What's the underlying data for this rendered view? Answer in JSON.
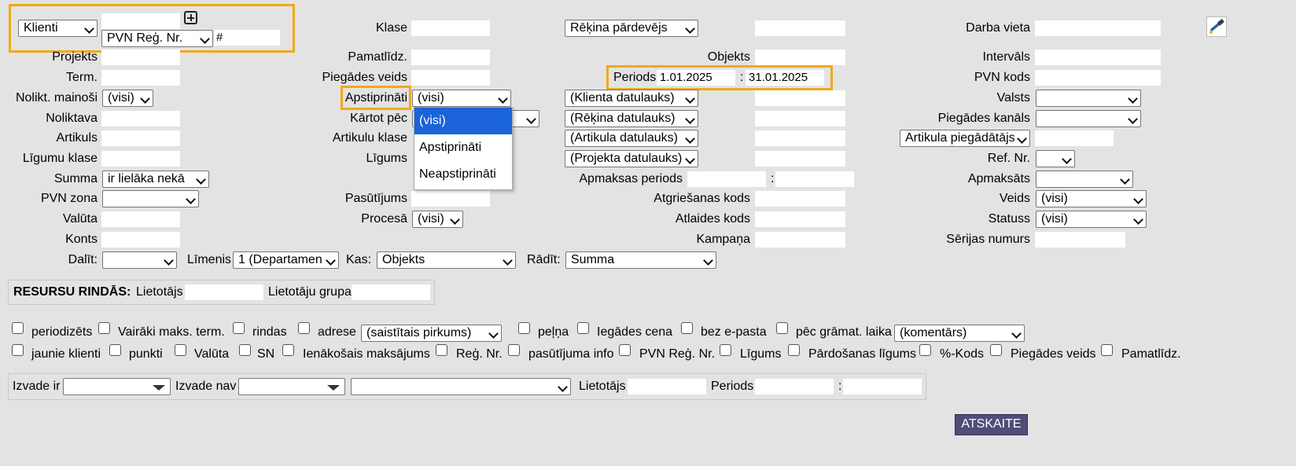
{
  "top": {
    "type_select": "Klienti",
    "vat_select": "PVN Reģ. Nr.",
    "hash": "#"
  },
  "col2": {
    "klase": "Klase",
    "pamatlidz": "Pamatlīdz.",
    "piegades_veids": "Piegādes veids",
    "apstiprinati": "Apstiprināti",
    "apstiprinati_value": "(visi)",
    "kartot_pec": "Kārtot pēc",
    "artikulu_klase": "Artikulu klase",
    "ligums": "Līgums",
    "pasutijums": "Pasūtījums",
    "procesa": "Procesā",
    "procesa_value": "(visi)"
  },
  "dropdown": {
    "options": [
      "(visi)",
      "Apstiprināti",
      "Neapstiprināti"
    ]
  },
  "col1": {
    "projekts": "Projekts",
    "term": "Term.",
    "nolikt_mainosi": "Nolikt. mainoši",
    "nolikt_mainosi_value": "(visi)",
    "noliktava": "Noliktava",
    "artikuls": "Artikuls",
    "ligumu_klase": "Līgumu klase",
    "summa": "Summa",
    "summa_value": "ir lielāka nekā",
    "pvn_zona": "PVN zona",
    "valuta": "Valūta",
    "konts": "Konts"
  },
  "col3": {
    "rekina_pardevejs": "Rēķina pārdevējs",
    "objekts": "Objekts",
    "periods": "Periods",
    "period_from": "1.01.2025",
    "period_to": "31.01.2025",
    "period_sep": ":",
    "klienta_datulauks": "(Klienta datulauks)",
    "rekina_datulauks": "(Rēķina datulauks)",
    "artikula_datulauks": "(Artikula datulauks)",
    "projekta_datulauks": "(Projekta datulauks)",
    "apmaksas_periods": "Apmaksas periods",
    "apmaksas_sep": ":",
    "atgriesanas_kods": "Atgriešanas kods",
    "atlaides_kods": "Atlaides kods",
    "kampana": "Kampaņa"
  },
  "col4": {
    "darba_vieta": "Darba vieta",
    "intervals": "Intervāls",
    "pvn_kods": "PVN kods",
    "valsts": "Valsts",
    "piegades_kanals": "Piegādes kanāls",
    "artikula_piegadatajs": "Artikula piegādātājs",
    "ref_nr": "Ref. Nr.",
    "apmaksats": "Apmaksāts",
    "veids": "Veids",
    "veids_value": "(visi)",
    "statuss": "Statuss",
    "statuss_value": "(visi)",
    "serijas_numurs": "Sērijas numurs"
  },
  "grouping": {
    "dalit": "Dalīt:",
    "limenis": "Līmenis",
    "limenis_value": "1 (Departamen",
    "kas": "Kas:",
    "kas_value": "Objekts",
    "radit": "Rādīt:",
    "radit_value": "Summa"
  },
  "resources": {
    "title": "RESURSU RINDĀS:",
    "lietotajs": "Lietotājs",
    "lietotaju_grupa": "Lietotāju grupa"
  },
  "checkboxes_row1": {
    "periodizets": "periodizēts",
    "vairaki": "Vairāki maks. term.",
    "rindas": "rindas",
    "adrese": "adrese",
    "adrese_select": "(saistītais pirkums)",
    "pelna": "peļņa",
    "iegades_cena": "Iegādes cena",
    "bez_epasta": "bez e-pasta",
    "pec_gramat": "pēc grāmat. laika",
    "komentars_select": "(komentārs)"
  },
  "checkboxes_row2": {
    "jaunie_klienti": "jaunie klienti",
    "punkti": "punkti",
    "valuta": "Valūta",
    "sn": "SN",
    "ienakosais": "Ienākošais maksājums",
    "reg_nr": "Reģ. Nr.",
    "pasutijuma_info": "pasūtījuma info",
    "pvn_reg_nr": "PVN Reģ. Nr.",
    "ligums": "Līgums",
    "pardosanas_ligums": "Pārdošanas līgums",
    "kods": "%-Kods",
    "piegades_veids": "Piegādes veids",
    "pamatlidz": "Pamatlīdz."
  },
  "output": {
    "izvade_ir": "Izvade ir",
    "izvade_nav": "Izvade nav",
    "lietotajs": "Lietotājs",
    "periods": "Periods",
    "sep": ":"
  },
  "report_button": "ATSKAITE",
  "colors": {
    "highlight": "#f0a91a",
    "background": "#e3e3e3",
    "button": "#4e4e78",
    "selected_option": "#1a63d8"
  },
  "icons": {
    "add": "plus-box-icon",
    "tool": "hammer-wrench-icon"
  }
}
